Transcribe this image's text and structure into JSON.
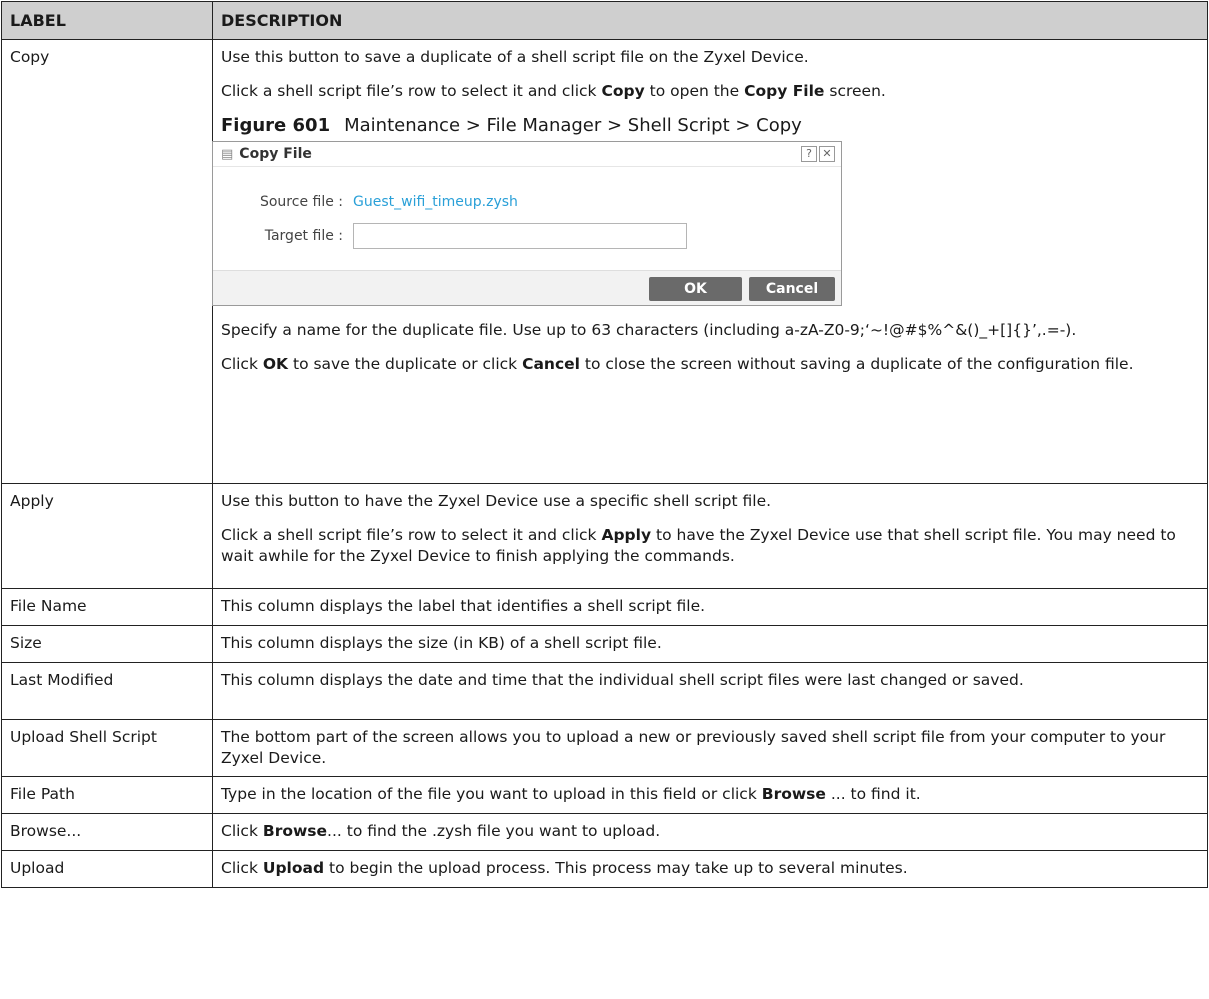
{
  "header": {
    "label": "LABEL",
    "description": "DESCRIPTION"
  },
  "rows": {
    "copy": {
      "label": "Copy",
      "p1": "Use this button to save a duplicate of a shell script file on the Zyxel Device.",
      "p2_a": "Click a shell script file’s row to select it and click ",
      "p2_b": "Copy",
      "p2_c": " to open the ",
      "p2_d": "Copy File",
      "p2_e": " screen.",
      "figure_number": "Figure 601",
      "figure_caption": "Maintenance > File Manager > Shell Script > Copy",
      "p3": "Specify a name for the duplicate file. Use up to 63 characters (including a-zA-Z0-9;‘~!@#$%^&()_+[]{}’,.=-).",
      "p4_a": "Click ",
      "p4_b": "OK",
      "p4_c": " to save the duplicate or click ",
      "p4_d": "Cancel",
      "p4_e": " to close the screen without saving a duplicate of the configuration file."
    },
    "apply": {
      "label": "Apply",
      "p1": "Use this button to have the Zyxel Device use a specific shell script file.",
      "p2_a": "Click a shell script file’s row to select it and click ",
      "p2_b": "Apply",
      "p2_c": " to have the Zyxel Device use that shell script file. You may need to wait awhile for the Zyxel Device to finish applying the commands."
    },
    "file_name": {
      "label": "File Name",
      "desc": "This column displays the label that identifies a shell script file."
    },
    "size": {
      "label": "Size",
      "desc": "This column displays the size (in KB) of a shell script file."
    },
    "last_modified": {
      "label": "Last Modified",
      "desc": "This column displays the date and time that the individual shell script files were last changed or saved."
    },
    "upload_shell_script": {
      "label": "Upload Shell Script",
      "desc": "The bottom part of the screen allows you to upload a new or previously saved shell script file from your computer to your Zyxel Device."
    },
    "file_path": {
      "label": "File Path",
      "desc_a": "Type in the location of the file you want to upload in this field or click ",
      "desc_b": "Browse",
      "desc_c": " ... to find it."
    },
    "browse": {
      "label": "Browse...",
      "desc_a": "Click ",
      "desc_b": "Browse",
      "desc_c": "... to find the .zysh file you want to upload."
    },
    "upload": {
      "label": "Upload",
      "desc_a": "Click ",
      "desc_b": "Upload",
      "desc_c": " to begin the upload process. This process may take up to several minutes."
    }
  },
  "dialog": {
    "title": "Copy File",
    "title_icon": "document-icon",
    "help_icon": "?",
    "close_icon": "✕",
    "source_label": "Source file :",
    "source_value": "Guest_wifi_timeup.zysh",
    "target_label": "Target file :",
    "target_value": "",
    "ok_label": "OK",
    "cancel_label": "Cancel",
    "accent_color": "#2aa0d8"
  }
}
